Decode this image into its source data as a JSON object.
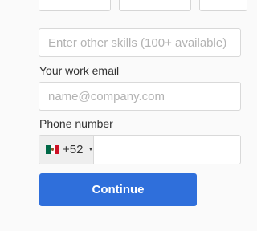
{
  "skills": {
    "other_placeholder": "Enter other skills (100+ available)"
  },
  "email": {
    "label": "Your work email",
    "placeholder": "name@company.com"
  },
  "phone": {
    "label": "Phone number",
    "country_code": "+52",
    "flag_icon": "mexico-flag-icon",
    "value": ""
  },
  "actions": {
    "continue_label": "Continue"
  },
  "colors": {
    "primary": "#2f6fdb",
    "border": "#d9d9d9",
    "background": "#fafafa"
  }
}
